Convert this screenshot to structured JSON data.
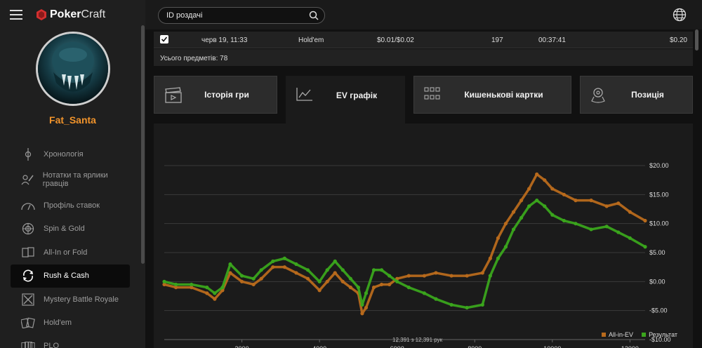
{
  "app": {
    "logo_bold": "Poker",
    "logo_light": "Craft"
  },
  "user": {
    "name": "Fat_Santa"
  },
  "sidebar": {
    "items": [
      {
        "label": "Хронологія",
        "icon": "timeline-icon"
      },
      {
        "label": "Нотатки та ярлики гравців",
        "icon": "notes-icon"
      },
      {
        "label": "Профіль ставок",
        "icon": "gauge-icon"
      },
      {
        "label": "Spin & Gold",
        "icon": "spin-gold-icon"
      },
      {
        "label": "All-In or Fold",
        "icon": "cards-icon"
      },
      {
        "label": "Rush & Cash",
        "icon": "rush-cash-icon"
      },
      {
        "label": "Mystery Battle Royale",
        "icon": "battle-royale-icon"
      },
      {
        "label": "Hold'em",
        "icon": "holdem-icon"
      },
      {
        "label": "PLO",
        "icon": "plo-icon"
      }
    ],
    "active_index": 5
  },
  "search": {
    "value": "ID роздачі"
  },
  "table_row": {
    "date": "черв 19, 11:33",
    "game": "Hold'em",
    "stakes": "$0.01/$0.02",
    "hands": "197",
    "duration": "00:37:41",
    "result": "$0.20"
  },
  "total_label": "Усього предметів: 78",
  "tabs": [
    {
      "label": "Історія гри",
      "icon": "clapper-icon"
    },
    {
      "label": "EV графік",
      "icon": "line-chart-icon"
    },
    {
      "label": "Кишенькові картки",
      "icon": "grid-icon"
    },
    {
      "label": "Позиція",
      "icon": "position-icon"
    }
  ],
  "active_tab": 1,
  "hands_label": "12,391 з 12,391 рук",
  "colors": {
    "all_in_ev": "#b86a1c",
    "result": "#3aa51c",
    "accent": "#f0932b"
  },
  "chart_data": {
    "type": "line",
    "x_ticks": [
      "2000",
      "4000",
      "6000",
      "8000",
      "10000",
      "12000"
    ],
    "y_ticks": [
      "$20.00",
      "$15.00",
      "$10.00",
      "$5.00",
      "$0.00",
      "-$5.00",
      "-$10.00"
    ],
    "xlim": [
      0,
      12391
    ],
    "ylim": [
      -10,
      20
    ],
    "grid": true,
    "legend_position": "bottom-right",
    "series": [
      {
        "name": "All-in-EV",
        "x": [
          0,
          300,
          700,
          1100,
          1300,
          1500,
          1700,
          2000,
          2300,
          2500,
          2800,
          3100,
          3400,
          3700,
          4000,
          4200,
          4400,
          4600,
          4800,
          5000,
          5100,
          5200,
          5400,
          5600,
          5800,
          6000,
          6300,
          6700,
          7000,
          7400,
          7800,
          8200,
          8400,
          8600,
          8800,
          9000,
          9200,
          9400,
          9600,
          9800,
          10000,
          10300,
          10600,
          11000,
          11400,
          11700,
          12000,
          12391
        ],
        "y": [
          -0.5,
          -1,
          -1,
          -2,
          -3,
          -1.5,
          1.5,
          0,
          -0.5,
          0.5,
          2.5,
          2.5,
          1.5,
          0.5,
          -1.5,
          0,
          1.5,
          0,
          -1,
          -2,
          -5.5,
          -4.5,
          -1,
          -0.5,
          -0.5,
          0.5,
          1,
          1,
          1.5,
          1,
          1,
          1.5,
          4,
          7.5,
          10,
          12,
          14,
          16,
          18.5,
          17.5,
          16,
          15,
          14,
          14,
          13,
          13.5,
          12,
          10.5
        ]
      },
      {
        "name": "Результат",
        "x": [
          0,
          300,
          700,
          1100,
          1300,
          1500,
          1700,
          2000,
          2300,
          2500,
          2800,
          3100,
          3400,
          3700,
          4000,
          4200,
          4400,
          4600,
          4800,
          5000,
          5100,
          5200,
          5400,
          5600,
          5800,
          6000,
          6300,
          6700,
          7000,
          7400,
          7800,
          8200,
          8400,
          8600,
          8800,
          9000,
          9200,
          9400,
          9600,
          9800,
          10000,
          10300,
          10600,
          11000,
          11400,
          11700,
          12000,
          12391
        ],
        "y": [
          0,
          -0.5,
          -0.5,
          -1,
          -2,
          -1,
          3,
          1,
          0.5,
          2,
          3.5,
          4,
          3,
          2,
          0,
          2,
          3.5,
          2,
          0.5,
          -1,
          -4,
          -2,
          2,
          2,
          1,
          0,
          -1,
          -2,
          -3,
          -4,
          -4.5,
          -4,
          1,
          4,
          6,
          9,
          11,
          13,
          14,
          13,
          11.5,
          10.5,
          10,
          9,
          9.5,
          8.5,
          7.5,
          6
        ]
      }
    ]
  }
}
